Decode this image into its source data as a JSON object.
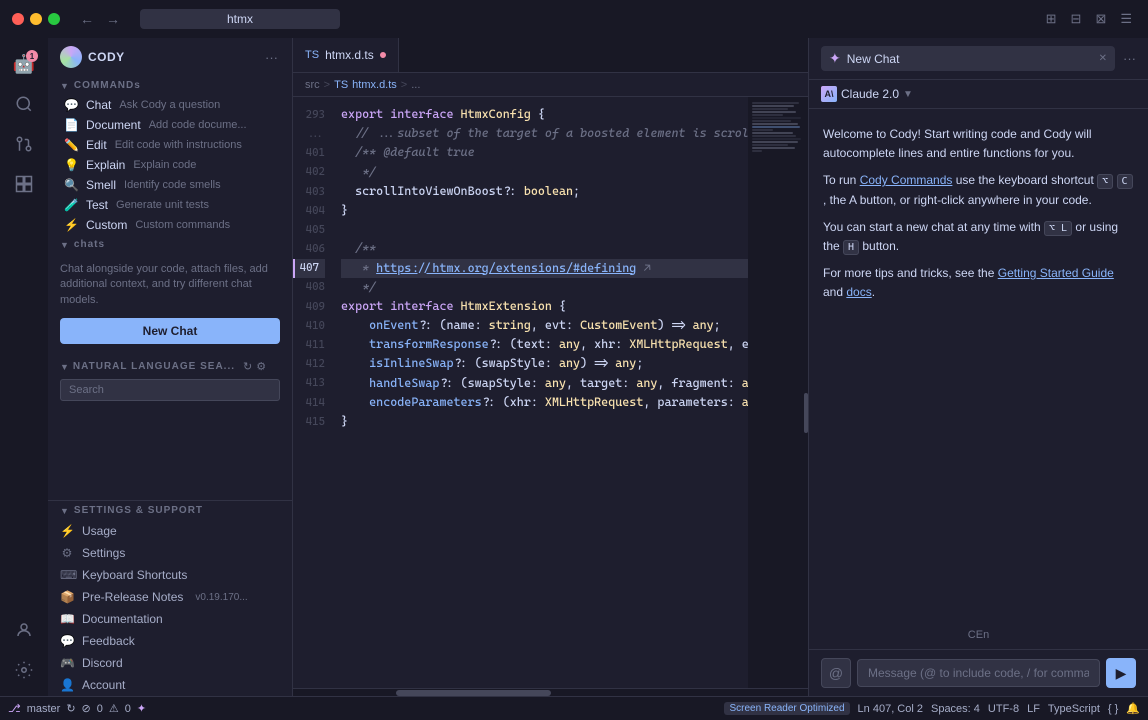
{
  "titlebar": {
    "search_placeholder": "htmx"
  },
  "editor": {
    "tab_filename": "htmx.d.ts",
    "breadcrumb": {
      "parts": [
        "src",
        ">",
        "TS htmx.d.ts",
        ">",
        "..."
      ]
    },
    "lines": [
      {
        "num": "293",
        "content": "export interface HtmxConfig {",
        "tokens": [
          {
            "t": "kw",
            "v": "export"
          },
          {
            "t": "tx",
            "v": " "
          },
          {
            "t": "kw",
            "v": "interface"
          },
          {
            "t": "tx",
            "v": " "
          },
          {
            "t": "ty",
            "v": "HtmxConfig"
          },
          {
            "t": "tx",
            "v": " {"
          }
        ]
      },
      {
        "num": "...",
        "content": "  // ...subset of the target of a boosted element is scrolled into the viewp...",
        "tokens": [
          {
            "t": "cm",
            "v": "  // ...subset of the target of a boosted element is scrolled into the viewp..."
          }
        ]
      },
      {
        "num": "401",
        "content": "  /** @default true",
        "tokens": [
          {
            "t": "cm",
            "v": "  /** @default true"
          }
        ]
      },
      {
        "num": "402",
        "content": "   */",
        "tokens": [
          {
            "t": "cm",
            "v": "   */"
          }
        ]
      },
      {
        "num": "403",
        "content": "  scrollIntoViewOnBoost?: boolean;",
        "tokens": [
          {
            "t": "tx",
            "v": "  scrollIntoViewOnBoost?: "
          },
          {
            "t": "ty",
            "v": "boolean"
          },
          {
            "t": "tx",
            "v": ";"
          }
        ]
      },
      {
        "num": "404",
        "content": "}",
        "tokens": [
          {
            "t": "tx",
            "v": "}"
          }
        ]
      },
      {
        "num": "405",
        "content": "",
        "tokens": []
      },
      {
        "num": "406",
        "content": "  /**",
        "tokens": [
          {
            "t": "cm",
            "v": "  /**"
          }
        ]
      },
      {
        "num": "407",
        "content": "   * https://htmx.org/extensions/#defining",
        "tokens": [
          {
            "t": "cm",
            "v": "   * "
          },
          {
            "t": "link",
            "v": "https://htmx.org/extensions/#defining"
          }
        ]
      },
      {
        "num": "408",
        "content": "   */",
        "tokens": [
          {
            "t": "cm",
            "v": "   */"
          }
        ]
      },
      {
        "num": "409",
        "content": "export interface HtmxExtension {",
        "tokens": [
          {
            "t": "kw",
            "v": "export"
          },
          {
            "t": "tx",
            "v": " "
          },
          {
            "t": "kw",
            "v": "interface"
          },
          {
            "t": "tx",
            "v": " "
          },
          {
            "t": "ty",
            "v": "HtmxExtension"
          },
          {
            "t": "tx",
            "v": " {"
          }
        ]
      },
      {
        "num": "410",
        "content": "    onEvent?: (name: string, evt: CustomEvent) => any;",
        "tokens": [
          {
            "t": "tx",
            "v": "    "
          },
          {
            "t": "fn",
            "v": "onEvent"
          },
          {
            "t": "tx",
            "v": "?: (name: "
          },
          {
            "t": "ty",
            "v": "string"
          },
          {
            "t": "tx",
            "v": ", evt: "
          },
          {
            "t": "ty",
            "v": "CustomEvent"
          },
          {
            "t": "tx",
            "v": ") => "
          },
          {
            "t": "ty",
            "v": "any"
          },
          {
            "t": "tx",
            "v": ";"
          }
        ]
      },
      {
        "num": "411",
        "content": "    transformResponse?: (text: any, xhr: XMLHttpRequest, elt: any) => any;",
        "tokens": [
          {
            "t": "tx",
            "v": "    "
          },
          {
            "t": "fn",
            "v": "transformResponse"
          },
          {
            "t": "tx",
            "v": "?: (text: "
          },
          {
            "t": "ty",
            "v": "any"
          },
          {
            "t": "tx",
            "v": ", xhr: "
          },
          {
            "t": "ty",
            "v": "XMLHttpRequest"
          },
          {
            "t": "tx",
            "v": ", elt: "
          },
          {
            "t": "ty",
            "v": "any"
          },
          {
            "t": "tx",
            "v": ") => "
          },
          {
            "t": "ty",
            "v": "any"
          },
          {
            "t": "tx",
            "v": ";"
          }
        ]
      },
      {
        "num": "412",
        "content": "    isInlineSwap?: (swapStyle: any) => any;",
        "tokens": [
          {
            "t": "tx",
            "v": "    "
          },
          {
            "t": "fn",
            "v": "isInlineSwap"
          },
          {
            "t": "tx",
            "v": "?: (swapStyle: "
          },
          {
            "t": "ty",
            "v": "any"
          },
          {
            "t": "tx",
            "v": ") => "
          },
          {
            "t": "ty",
            "v": "any"
          },
          {
            "t": "tx",
            "v": ";"
          }
        ]
      },
      {
        "num": "413",
        "content": "    handleSwap?: (swapStyle: any, target: any, fragment: any, settleInfo: any) =...",
        "tokens": [
          {
            "t": "tx",
            "v": "    "
          },
          {
            "t": "fn",
            "v": "handleSwap"
          },
          {
            "t": "tx",
            "v": "?: (swapStyle: "
          },
          {
            "t": "ty",
            "v": "any"
          },
          {
            "t": "tx",
            "v": ", target: "
          },
          {
            "t": "ty",
            "v": "any"
          },
          {
            "t": "tx",
            "v": ", fragment: "
          },
          {
            "t": "ty",
            "v": "any"
          },
          {
            "t": "tx",
            "v": ", settleInfo: "
          },
          {
            "t": "ty",
            "v": "any"
          },
          {
            "t": "tx",
            "v": ") =..."
          }
        ]
      },
      {
        "num": "414",
        "content": "    encodeParameters?: (xhr: XMLHttpRequest, parameters: any, elt: any) => any;",
        "tokens": [
          {
            "t": "tx",
            "v": "    "
          },
          {
            "t": "fn",
            "v": "encodeParameters"
          },
          {
            "t": "tx",
            "v": "?: (xhr: "
          },
          {
            "t": "ty",
            "v": "XMLHttpRequest"
          },
          {
            "t": "tx",
            "v": ", parameters: "
          },
          {
            "t": "ty",
            "v": "any"
          },
          {
            "t": "tx",
            "v": ", elt: "
          },
          {
            "t": "ty",
            "v": "any"
          },
          {
            "t": "tx",
            "v": ") => "
          },
          {
            "t": "ty",
            "v": "any"
          },
          {
            "t": "tx",
            "v": ";"
          }
        ]
      },
      {
        "num": "415",
        "content": "}",
        "tokens": [
          {
            "t": "tx",
            "v": "}"
          }
        ]
      }
    ]
  },
  "sidebar": {
    "title": "CODY",
    "sections": {
      "commands": {
        "label": "COMMANDs",
        "items": [
          {
            "icon": "💬",
            "name": "Chat",
            "desc": "Ask Cody a question"
          },
          {
            "icon": "📄",
            "name": "Document",
            "desc": "Add code docume..."
          },
          {
            "icon": "✏️",
            "name": "Edit",
            "desc": "Edit code with instructions"
          },
          {
            "icon": "💡",
            "name": "Explain",
            "desc": "Explain code"
          },
          {
            "icon": "👃",
            "name": "Smell",
            "desc": "Identify code smells"
          },
          {
            "icon": "🧪",
            "name": "Test",
            "desc": "Generate unit tests"
          },
          {
            "icon": "⚡",
            "name": "Custom",
            "desc": "Custom commands"
          }
        ]
      },
      "chats": {
        "label": "chats",
        "description": "Chat alongside your code, attach files, add additional context, and try different chat models.",
        "new_chat_label": "New Chat"
      },
      "nl_search": {
        "label": "NATURAL LANGUAGE SEA...",
        "search_placeholder": "Search"
      },
      "settings": {
        "label": "SETTINGS & SUPPORT",
        "items": [
          {
            "icon": "⚡",
            "name": "Usage"
          },
          {
            "icon": "⚙",
            "name": "Settings"
          },
          {
            "icon": "⌨",
            "name": "Keyboard Shortcuts"
          },
          {
            "icon": "📦",
            "name": "Pre-Release Notes",
            "badge": "v0.19.170..."
          },
          {
            "icon": "📖",
            "name": "Documentation"
          },
          {
            "icon": "💬",
            "name": "Feedback"
          },
          {
            "icon": "🎮",
            "name": "Discord"
          },
          {
            "icon": "👤",
            "name": "Account"
          }
        ]
      }
    }
  },
  "chat_panel": {
    "tab_title": "New Chat",
    "model_name": "Claude 2.0",
    "messages": [
      "Welcome to Cody! Start writing code and Cody will autocomplete lines and entire functions for you.",
      "To run Cody Commands use the keyboard shortcut ⌥ C , the A button, or right-click anywhere in your code.",
      "You can start a new chat at any time with ⌥ L or using the H button.",
      "For more tips and tricks, see the Getting Started Guide and docs."
    ],
    "input_placeholder": "Message (@ to include code, / for commands)",
    "cen_text": "CEn"
  },
  "status_bar": {
    "branch": "master",
    "errors": "0",
    "warnings": "0",
    "ln": "Ln 407, Col 2",
    "spaces": "Spaces: 4",
    "encoding": "UTF-8",
    "eol": "LF",
    "language": "TypeScript",
    "screen_reader": "Screen Reader Optimized",
    "ai_icon": "✦"
  }
}
